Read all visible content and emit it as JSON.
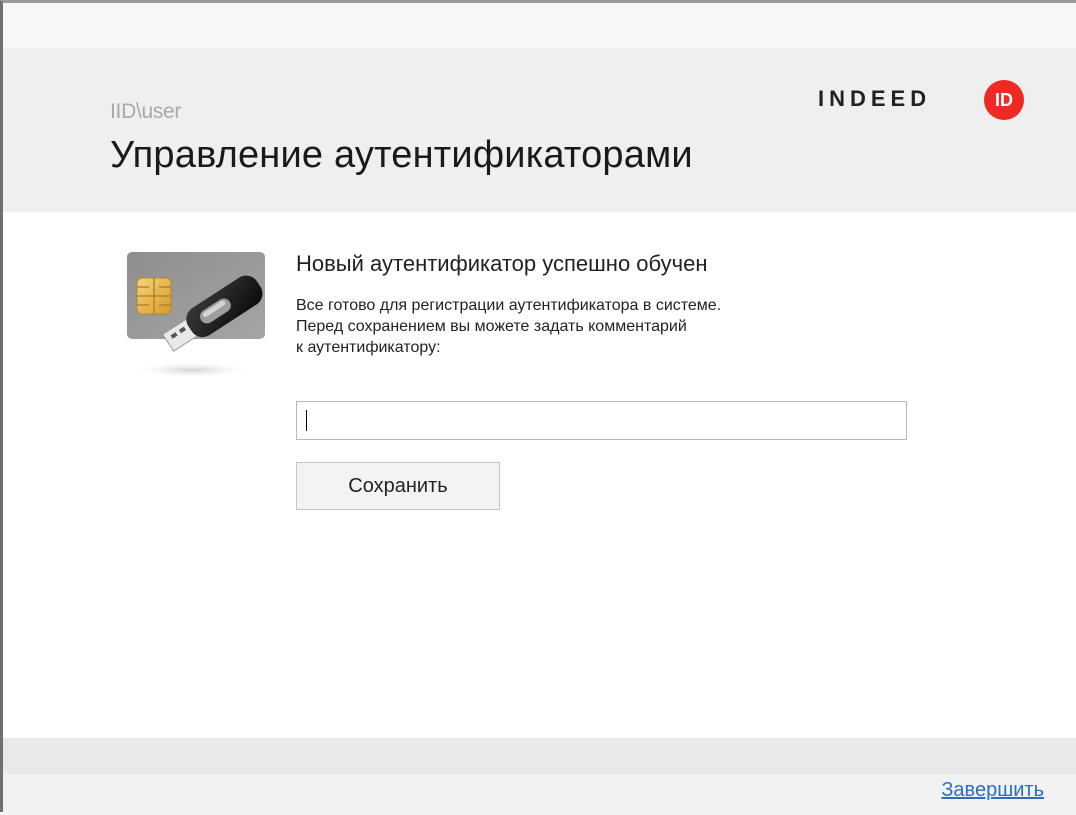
{
  "header": {
    "username": "IID\\user",
    "title": "Управление аутентификаторами"
  },
  "logo": {
    "text": "INDEED",
    "badge": "ID",
    "badge_color": "#ee2a24"
  },
  "content": {
    "image_icon": "smartcard-usb-token-icon",
    "title": "Новый аутентификатор успешно обучен",
    "description": "Все готово для регистрации аутентификатора в системе.\nПеред сохранением вы можете задать комментарий\nк аутентификатору:",
    "comment_value": "",
    "save_label": "Сохранить"
  },
  "footer": {
    "finish_label": "Завершить",
    "link_color": "#2a6ebf"
  }
}
